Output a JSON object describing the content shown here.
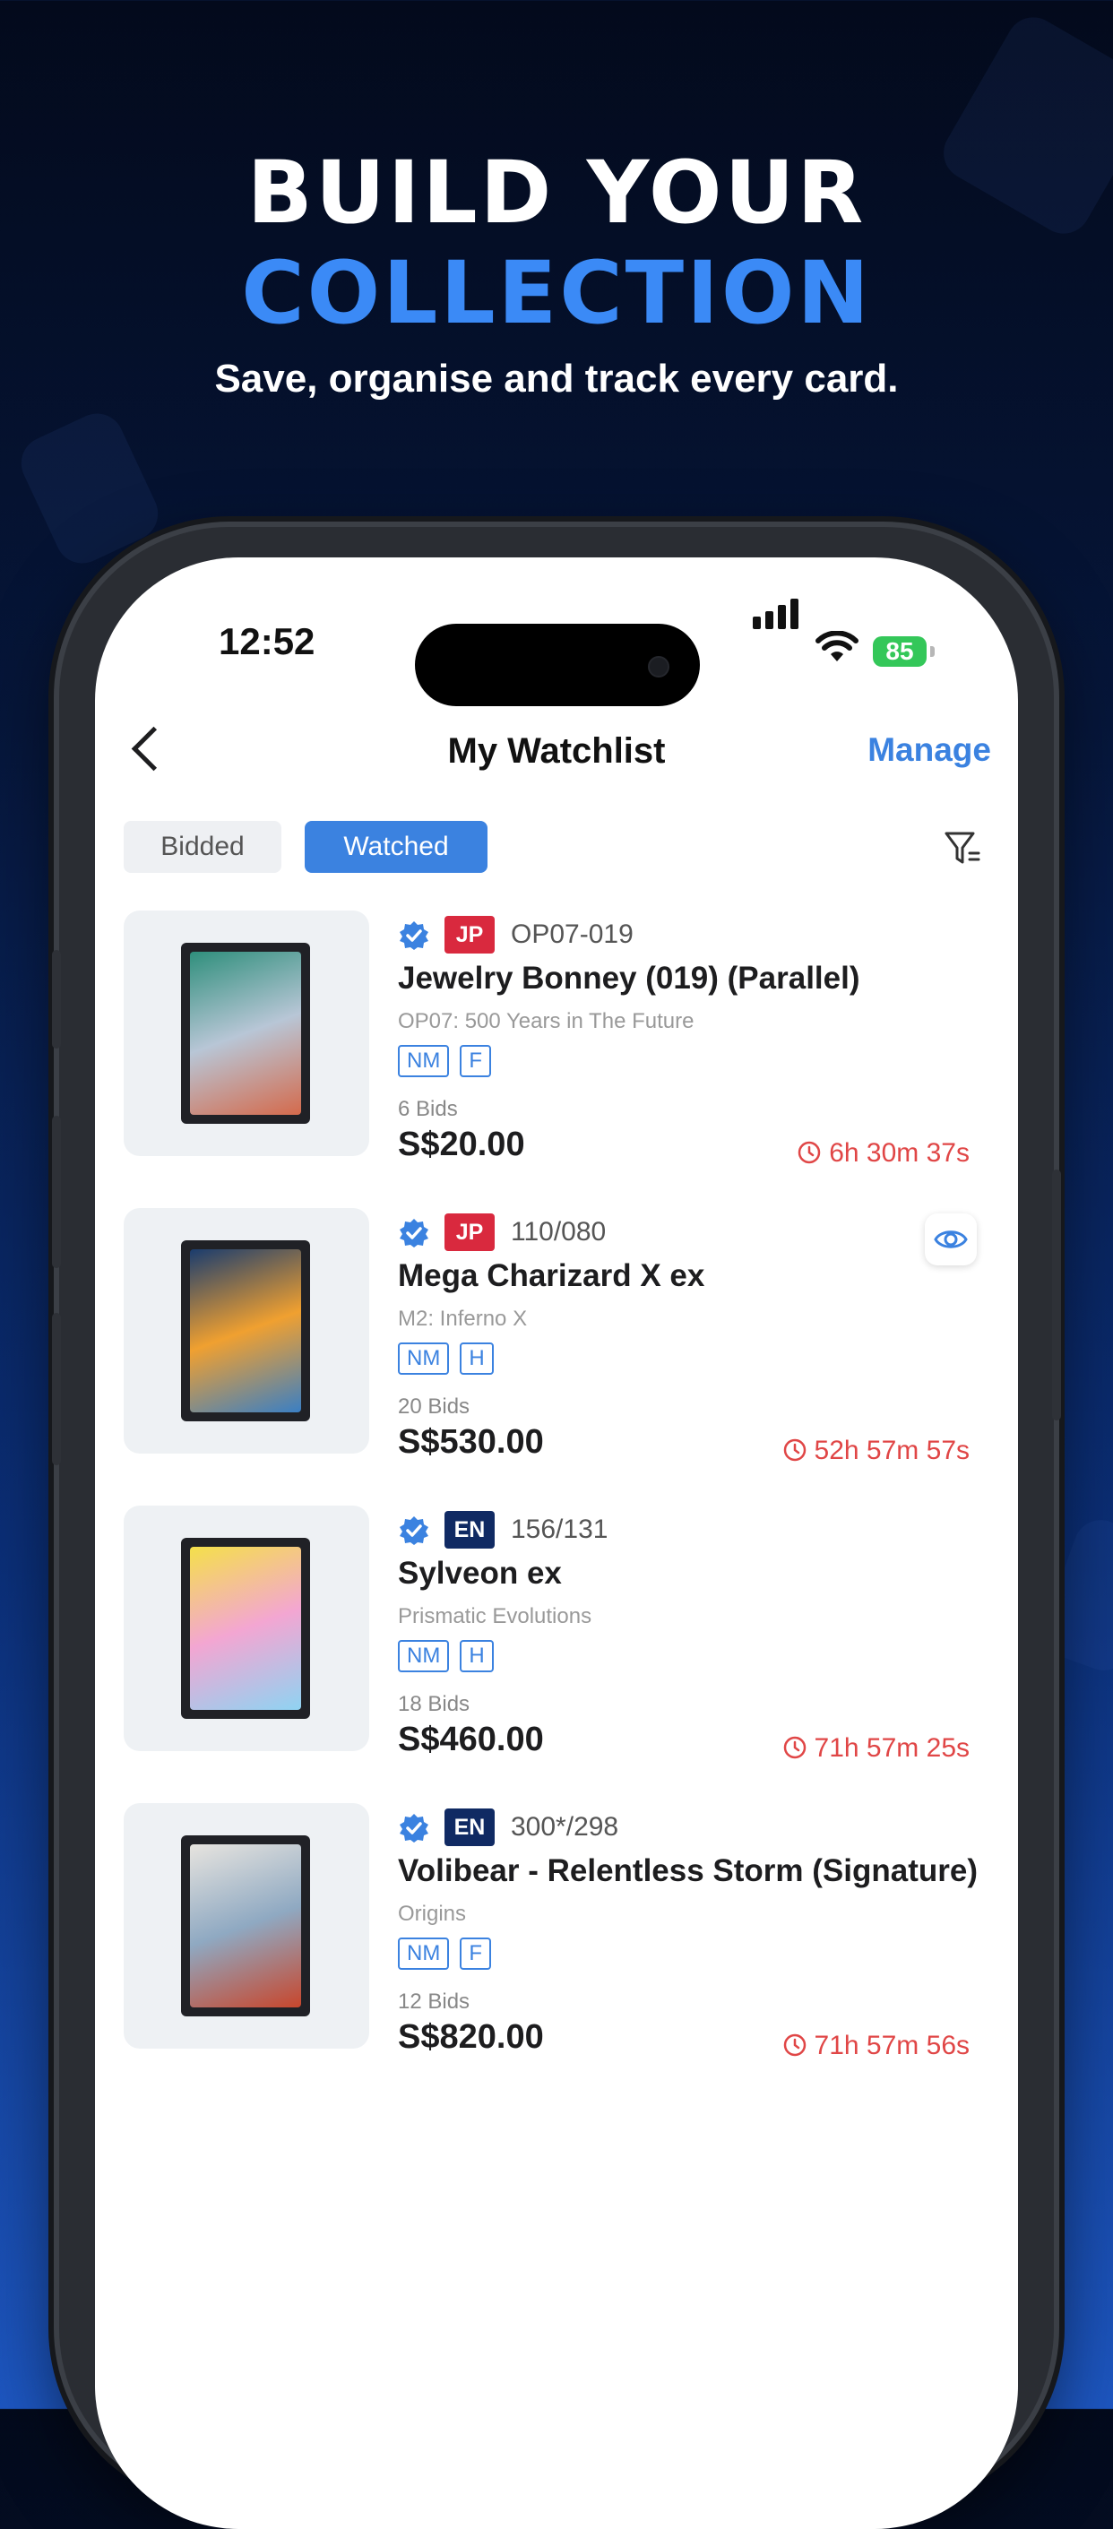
{
  "hero": {
    "line1": "BUILD YOUR",
    "line2": "COLLECTION",
    "subtitle": "Save, organise and track every card."
  },
  "status_bar": {
    "time": "12:52",
    "battery": "85"
  },
  "nav": {
    "title": "My Watchlist",
    "manage_label": "Manage"
  },
  "tabs": {
    "bidded": "Bidded",
    "watched": "Watched",
    "active": "Watched"
  },
  "items": [
    {
      "lang": "JP",
      "code": "OP07-019",
      "name": "Jewelry Bonney (019) (Parallel)",
      "set": "OP07: 500 Years in The Future",
      "conditions": [
        "NM",
        "F"
      ],
      "bids": "6 Bids",
      "price": "S$20.00",
      "time_left": "6h 30m 37s",
      "card_colors": [
        "#2f8f7c",
        "#b8c6d6",
        "#d46a4c"
      ],
      "watched_toggle": false
    },
    {
      "lang": "JP",
      "code": "110/080",
      "name": "Mega Charizard X ex",
      "set": "M2: Inferno X",
      "conditions": [
        "NM",
        "H"
      ],
      "bids": "20 Bids",
      "price": "S$530.00",
      "time_left": "52h 57m 57s",
      "card_colors": [
        "#1a3c6e",
        "#f0a030",
        "#3a7fc4"
      ],
      "watched_toggle": true
    },
    {
      "lang": "EN",
      "code": "156/131",
      "name": "Sylveon ex",
      "set": "Prismatic Evolutions",
      "conditions": [
        "NM",
        "H"
      ],
      "bids": "18 Bids",
      "price": "S$460.00",
      "time_left": "71h 57m 25s",
      "card_colors": [
        "#f4e04a",
        "#f3a6d2",
        "#8fd3f2"
      ],
      "watched_toggle": false
    },
    {
      "lang": "EN",
      "code": "300*/298",
      "name": "Volibear - Relentless Storm (Signature)",
      "set": "Origins",
      "conditions": [
        "NM",
        "F"
      ],
      "bids": "12 Bids",
      "price": "S$820.00",
      "time_left": "71h 57m 56s",
      "card_colors": [
        "#e7e4df",
        "#8fa9c2",
        "#c8462c"
      ],
      "watched_toggle": false
    }
  ]
}
